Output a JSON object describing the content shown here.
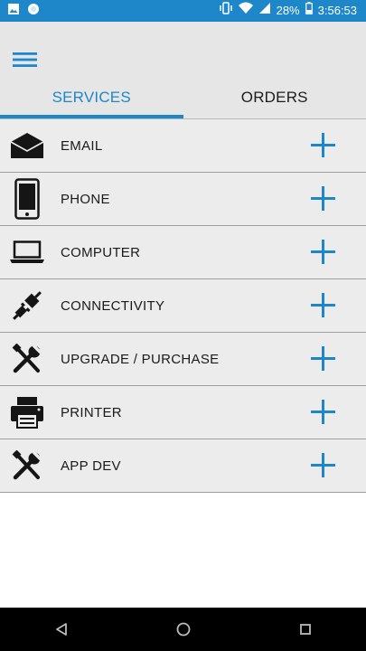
{
  "status_bar": {
    "battery": "28%",
    "time": "3:56:53",
    "icons": [
      "image-icon",
      "circle-notification-icon",
      "vibrate-icon",
      "wifi-icon",
      "signal-icon",
      "battery-icon"
    ]
  },
  "app_bar": {
    "menu_icon": "hamburger-menu-icon"
  },
  "tabs": [
    {
      "label": "SERVICES",
      "active": true
    },
    {
      "label": "ORDERS",
      "active": false
    }
  ],
  "services": [
    {
      "label": "EMAIL",
      "icon": "envelope-icon"
    },
    {
      "label": "PHONE",
      "icon": "phone-icon"
    },
    {
      "label": "COMPUTER",
      "icon": "laptop-icon"
    },
    {
      "label": "CONNECTIVITY",
      "icon": "plug-icon"
    },
    {
      "label": "UPGRADE / PURCHASE",
      "icon": "tools-icon"
    },
    {
      "label": "PRINTER",
      "icon": "printer-icon"
    },
    {
      "label": "APP DEV",
      "icon": "tools-icon"
    }
  ],
  "nav_bar": {
    "icons": [
      "back-icon",
      "home-icon",
      "recents-icon"
    ]
  },
  "colors": {
    "accent": "#1d87c9",
    "app_bar_bg": "#e6e6e6",
    "row_bg": "#ececec",
    "nav_bg": "#000000"
  }
}
